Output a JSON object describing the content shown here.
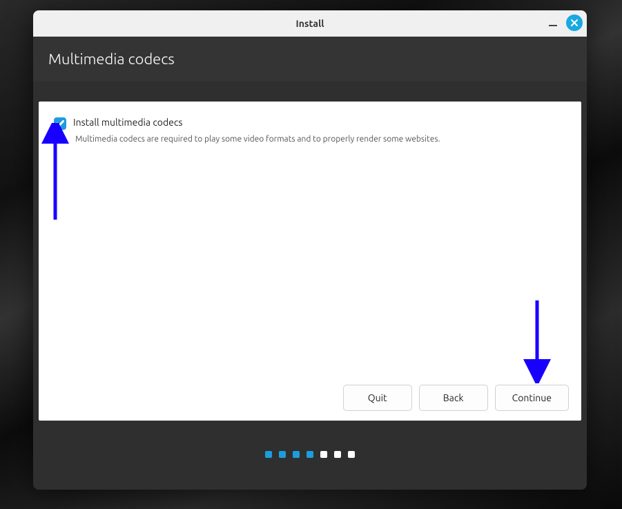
{
  "window": {
    "title": "Install"
  },
  "header": {
    "title": "Multimedia codecs"
  },
  "option": {
    "checked": true,
    "label": "Install multimedia codecs",
    "description": "Multimedia codecs are required to play some video formats and to properly render some websites."
  },
  "buttons": {
    "quit": "Quit",
    "back": "Back",
    "continue": "Continue"
  },
  "pager": {
    "total": 7,
    "current": 4
  },
  "colors": {
    "accent": "#1d9cde",
    "arrow": "#1800ff"
  }
}
